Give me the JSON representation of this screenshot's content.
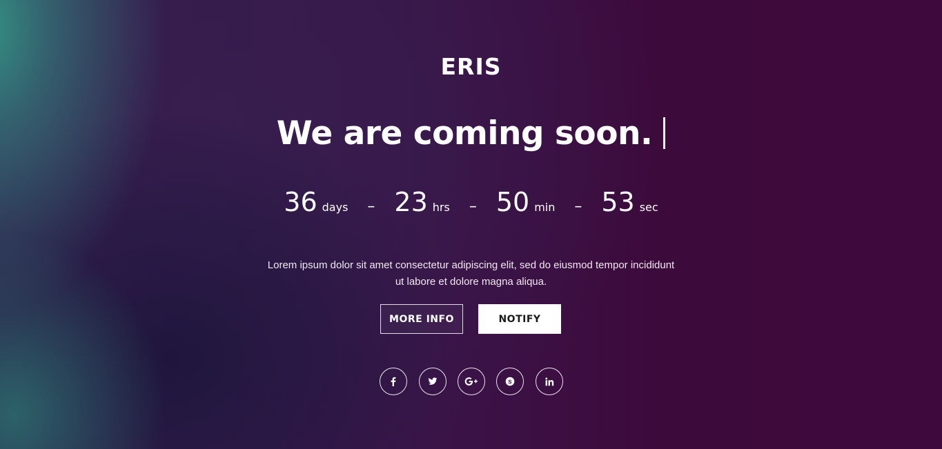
{
  "brand": "ERIS",
  "headline": "We are coming soon.",
  "countdown": {
    "days": {
      "value": "36",
      "label": "days"
    },
    "hours": {
      "value": "23",
      "label": "hrs"
    },
    "minutes": {
      "value": "50",
      "label": "min"
    },
    "seconds": {
      "value": "53",
      "label": "sec"
    },
    "separator": "–"
  },
  "description": "Lorem ipsum dolor sit amet consectetur adipiscing elit, sed do eiusmod tempor incididunt ut labore et dolore magna aliqua.",
  "buttons": {
    "more_info": "MORE INFO",
    "notify": "NOTIFY"
  },
  "social": [
    {
      "icon": "facebook-icon"
    },
    {
      "icon": "twitter-icon"
    },
    {
      "icon": "google-plus-icon"
    },
    {
      "icon": "skype-icon"
    },
    {
      "icon": "linkedin-icon"
    }
  ],
  "colors": {
    "background": "#3c0a3c",
    "accent_teal": "#349687",
    "text": "#ffffff",
    "notify_button_bg": "#ffffff"
  }
}
